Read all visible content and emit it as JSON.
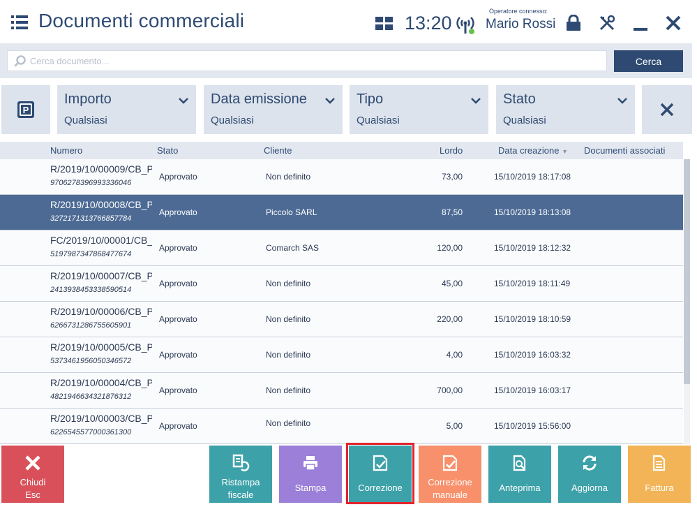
{
  "header": {
    "title": "Documenti commerciali",
    "time": "13:20",
    "operator_label": "Operatore connesso:",
    "operator_name": "Mario Rossi"
  },
  "search": {
    "placeholder": "Cerca documento...",
    "value": "",
    "button_label": "Cerca"
  },
  "filters": [
    {
      "label": "Importo",
      "value": "Qualsiasi"
    },
    {
      "label": "Data emissione",
      "value": "Qualsiasi"
    },
    {
      "label": "Tipo",
      "value": "Qualsiasi"
    },
    {
      "label": "Stato",
      "value": "Qualsiasi"
    }
  ],
  "parking_label": "P",
  "table": {
    "columns": [
      "Numero",
      "Stato",
      "Cliente",
      "Lordo",
      "Data creazione",
      "Documenti associati"
    ],
    "sort_indicator": "▼",
    "rows": [
      {
        "numero": "R/2019/10/00009/CB_P",
        "codice": "9706278396993336046",
        "stato": "Approvato",
        "cliente": "Non definito",
        "lordo": "73,00",
        "data": "15/10/2019 18:17:08"
      },
      {
        "numero": "R/2019/10/00008/CB_P",
        "codice": "3272171313766857784",
        "stato": "Approvato",
        "cliente": "Piccolo SARL",
        "lordo": "87,50",
        "data": "15/10/2019 18:13:08"
      },
      {
        "numero": "FC/2019/10/00001/CB_",
        "codice": "5197987347868477674",
        "stato": "Approvato",
        "cliente": "Comarch SAS",
        "lordo": "120,00",
        "data": "15/10/2019 18:12:32"
      },
      {
        "numero": "R/2019/10/00007/CB_P",
        "codice": "2413938453338590514",
        "stato": "Approvato",
        "cliente": "Non definito",
        "lordo": "45,00",
        "data": "15/10/2019 18:11:49"
      },
      {
        "numero": "R/2019/10/00006/CB_P",
        "codice": "6266731286755605901",
        "stato": "Approvato",
        "cliente": "Non definito",
        "lordo": "220,00",
        "data": "15/10/2019 18:10:59"
      },
      {
        "numero": "R/2019/10/00005/CB_P",
        "codice": "5373461956050346572",
        "stato": "Approvato",
        "cliente": "Non definito",
        "lordo": "4,00",
        "data": "15/10/2019 16:03:32"
      },
      {
        "numero": "R/2019/10/00004/CB_P",
        "codice": "4821946634321876312",
        "stato": "Approvato",
        "cliente": "Non definito",
        "lordo": "700,00",
        "data": "15/10/2019 16:03:17"
      },
      {
        "numero": "R/2019/10/00003/CB_P",
        "codice": "6226545577000361300",
        "stato": "Approvato",
        "cliente": "Non definito",
        "lordo": "5,00",
        "data": "15/10/2019 15:56:00"
      }
    ],
    "selected_row_index": 1
  },
  "buttons": {
    "chiudi": [
      "Chiudi",
      "Esc"
    ],
    "ristampa": [
      "Ristampa",
      "fiscale"
    ],
    "stampa": "Stampa",
    "correzione": "Correzione",
    "correzione_manuale": [
      "Correzione",
      "manuale"
    ],
    "anteprima": "Anteprima",
    "aggiorna": "Aggiorna",
    "fattura": "Fattura"
  },
  "colors": {
    "brand": "#2e4a73",
    "selected_row": "#4c6a94",
    "chiudi": "#d9505a",
    "teal": "#3da1a9",
    "purple": "#9b7fd8",
    "correzione_manuale": "#f7906b",
    "fattura": "#f2b457",
    "highlight": "#e5232d"
  },
  "icons": [
    "menu-icon",
    "grid-icon",
    "signal-icon",
    "lock-icon",
    "tools-icon",
    "minimize-icon",
    "close-icon",
    "search-icon",
    "chevron-down-icon",
    "parking-icon",
    "clear-filter-icon",
    "reprint-icon",
    "printer-icon",
    "correction-icon",
    "manual-correction-icon",
    "preview-icon",
    "refresh-icon",
    "invoice-icon"
  ]
}
